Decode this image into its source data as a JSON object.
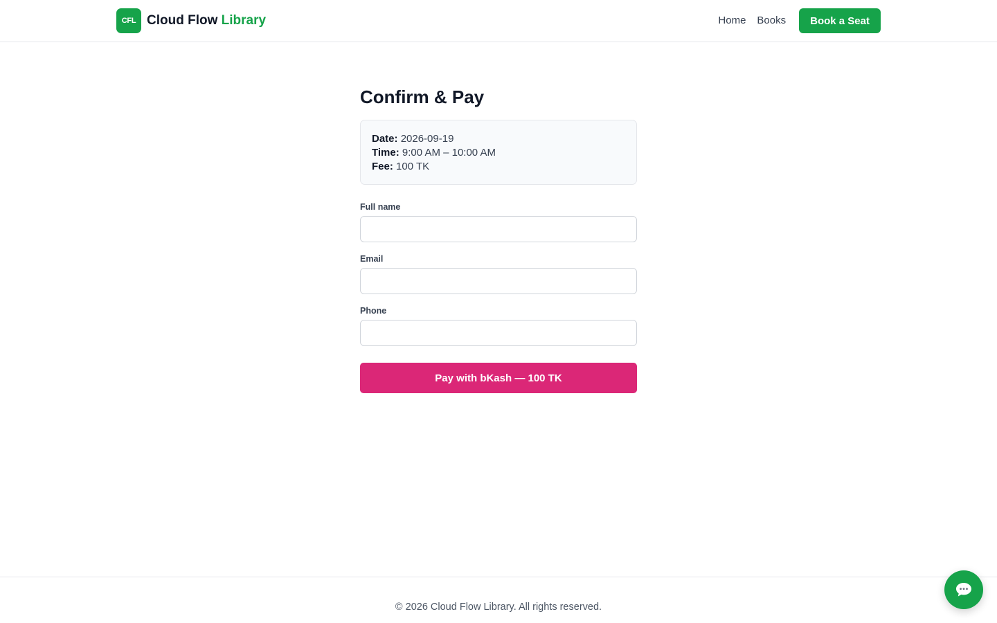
{
  "header": {
    "logo_badge": "CFL",
    "brand_main": "Cloud Flow",
    "brand_accent": "Library",
    "nav": {
      "home": "Home",
      "books": "Books",
      "cta": "Book a Seat"
    }
  },
  "main": {
    "title": "Confirm & Pay",
    "summary": {
      "date_label": "Date:",
      "date_value": "2026-09-19",
      "time_label": "Time:",
      "time_value": "9:00 AM – 10:00 AM",
      "fee_label": "Fee:",
      "fee_value": "100 TK"
    },
    "form": {
      "full_name_label": "Full name",
      "full_name_value": "",
      "email_label": "Email",
      "email_value": "",
      "phone_label": "Phone",
      "phone_value": ""
    },
    "pay_button": "Pay with bKash — 100 TK"
  },
  "footer": {
    "text": "© 2026 Cloud Flow Library. All rights reserved."
  },
  "chat": {
    "icon": "chat-bubble-icon"
  },
  "colors": {
    "brand_green": "#16a34a",
    "bkash_pink": "#db2777"
  }
}
